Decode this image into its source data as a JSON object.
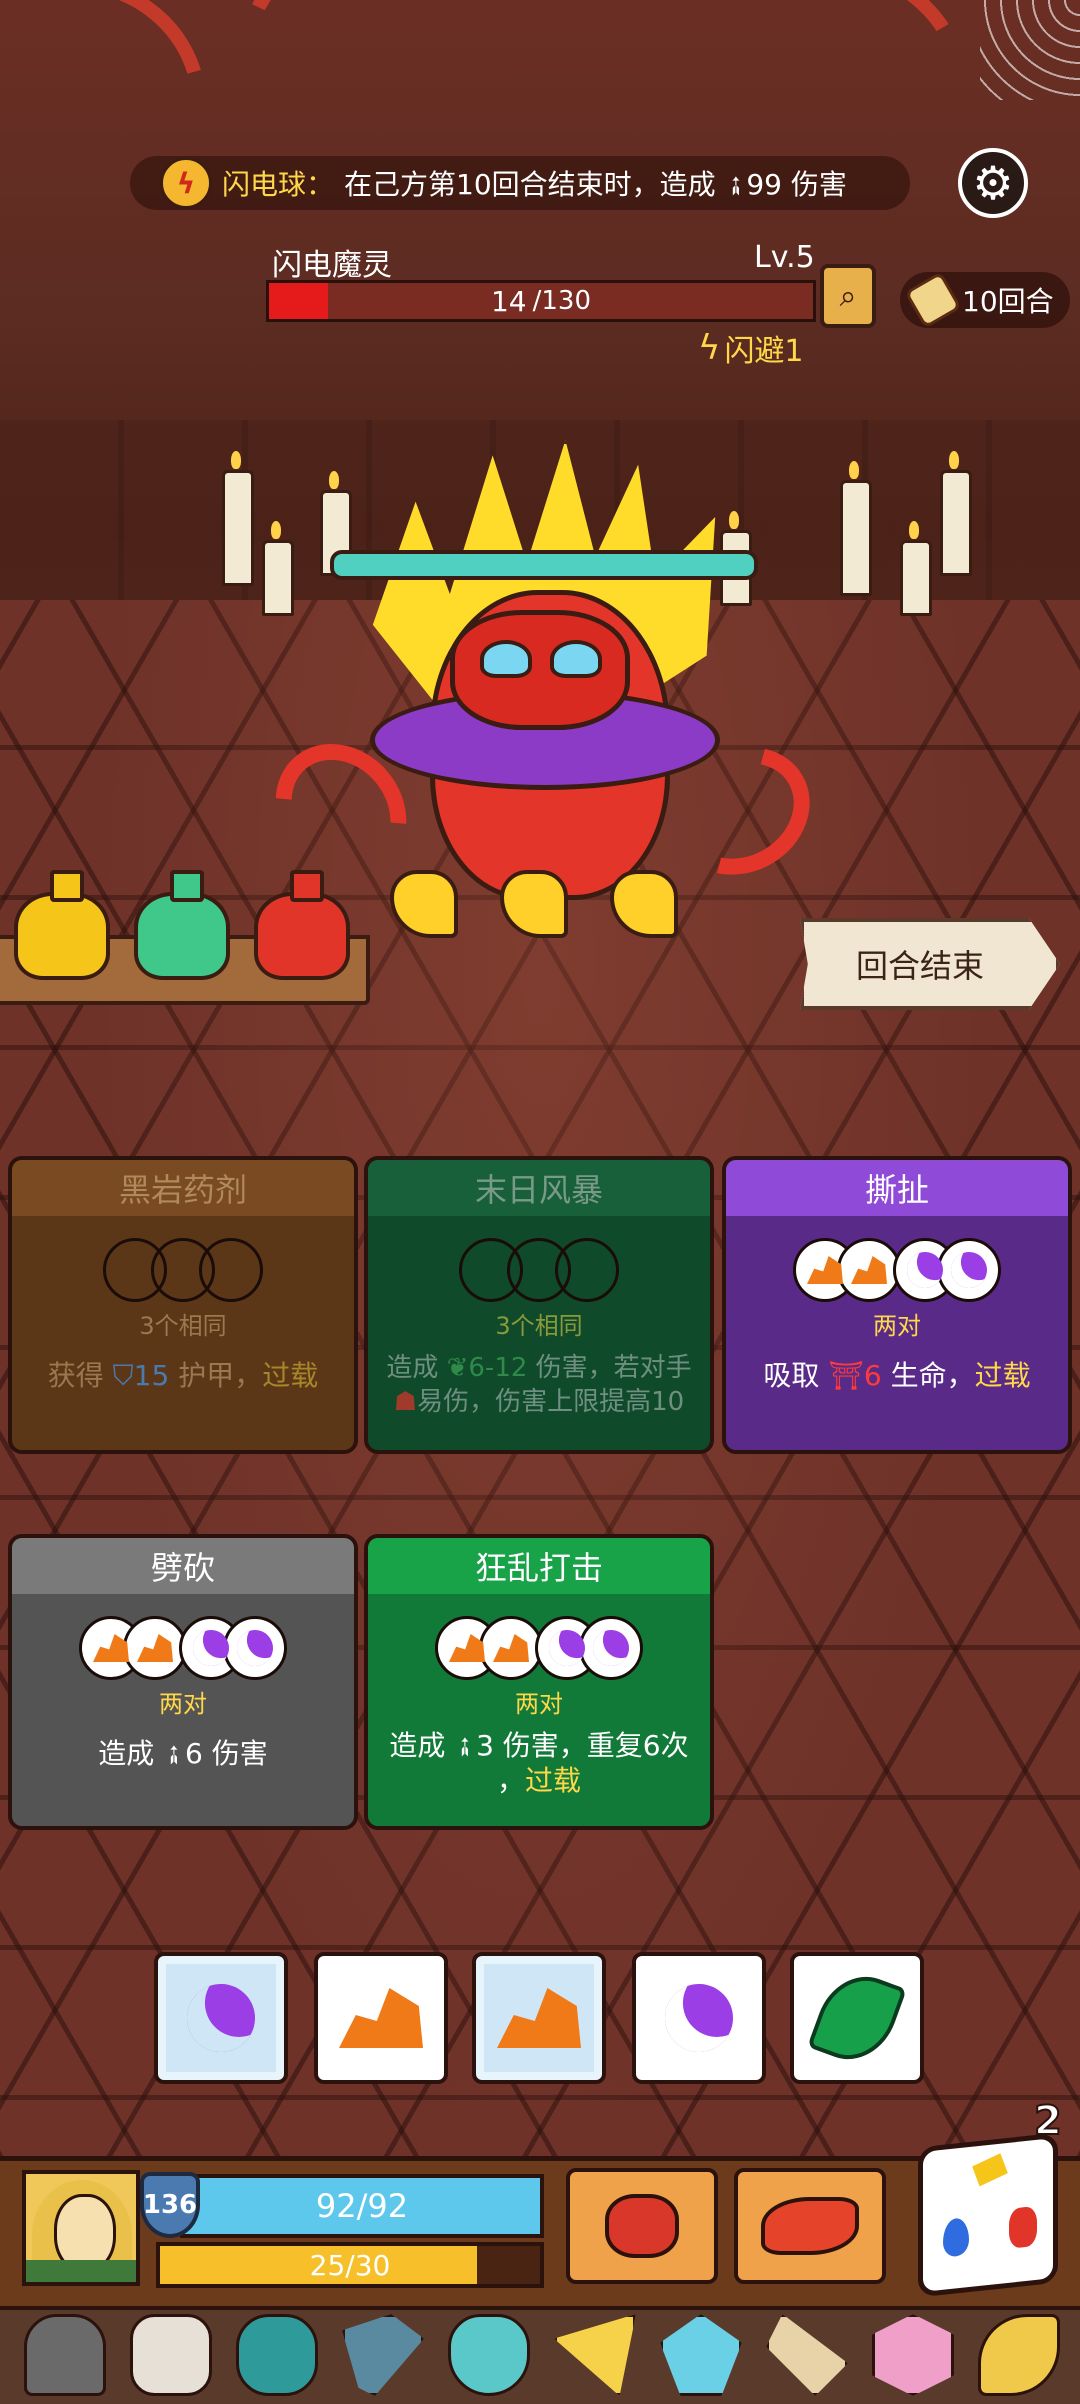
{
  "banner": {
    "icon": "lightning-ball-icon",
    "name": "闪电球：",
    "text_before": "在己方第10回合结束时，造成 ",
    "damage": "99",
    "text_after": " 伤害"
  },
  "enemy": {
    "name": "闪电魔灵",
    "level": "Lv.5",
    "hp_current": "14",
    "hp_max": " /130",
    "hp_fraction": 0.108,
    "dodge_label": "闪避1"
  },
  "turn_counter": "10回合",
  "end_turn_label": "回合结束",
  "potions": [
    {
      "name": "yellow-potion",
      "color": "#f5c51a"
    },
    {
      "name": "green-potion",
      "color": "#3fc88a"
    },
    {
      "name": "red-potion",
      "color": "#e2352a"
    }
  ],
  "cards": {
    "c1": {
      "title": "黑岩药剂",
      "req": "3个相同",
      "desc_a": "获得 ",
      "value": "15",
      "desc_b": " 护甲，",
      "kw": "过载"
    },
    "c2": {
      "title": "末日风暴",
      "req": "3个相同",
      "line1_a": "造成 ",
      "value": "6-12",
      "line1_b": " 伤害，若对手",
      "line2": "易伤，伤害上限提高10"
    },
    "c3": {
      "title": "撕扯",
      "req": "两对",
      "desc_a": "吸取 ",
      "value": "6",
      "desc_b": " 生命，",
      "kw": "过载"
    },
    "c4": {
      "title": "劈砍",
      "req": "两对",
      "desc_a": "造成 ",
      "value": "6",
      "desc_b": " 伤害"
    },
    "c5": {
      "title": "狂乱打击",
      "req": "两对",
      "line1_a": "造成 ",
      "value": "3",
      "line1_b": " 伤害，重复6次",
      "line2_a": "，",
      "kw": "过载"
    }
  },
  "dice": [
    {
      "face": "moon",
      "frozen": true
    },
    {
      "face": "rock",
      "frozen": false
    },
    {
      "face": "rock",
      "frozen": true
    },
    {
      "face": "moon",
      "frozen": false
    },
    {
      "face": "leaf",
      "frozen": false
    }
  ],
  "reroll_count": "2",
  "player": {
    "armor": "136",
    "hp": "92/92",
    "hp_fraction": 1.0,
    "energy": "25/30",
    "energy_fraction": 0.833
  },
  "relics": [
    "helmet-relic-icon",
    "bull-skull-relic-icon",
    "demon-mask-relic-icon",
    "pickaxe-relic-icon",
    "vase-relic-icon",
    "cheese-relic-icon",
    "crystal-relic-icon",
    "horn-relic-icon",
    "d20-relic-icon",
    "claw-relic-icon"
  ],
  "colors": {
    "accent_yellow": "#ffd84a",
    "hp_red": "#e51b1b",
    "player_hp": "#5ec8ec",
    "energy": "#f7c02a"
  }
}
